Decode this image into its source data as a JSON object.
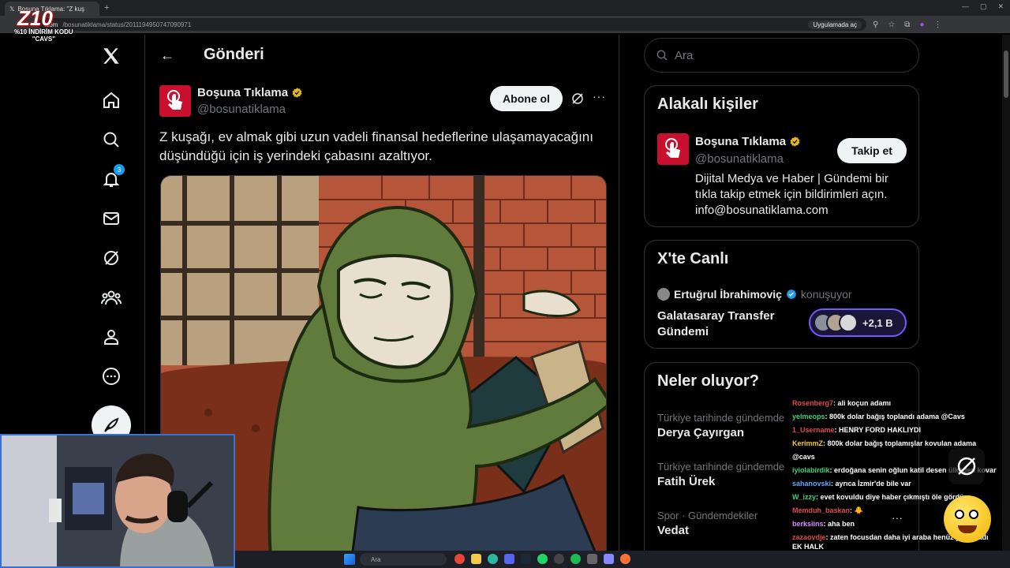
{
  "browser": {
    "tab_title": "Boşuna Tıklama: \"Z kuş",
    "new_tab": "+",
    "url_host": ".com",
    "url_path": "/bosunatiklama/status/2011194950747090971",
    "open_app": "Uygulamada aç"
  },
  "overlay": {
    "logo": "Z10",
    "promo_line1": "%10 İNDİRİM KODU",
    "promo_line2": "\"CAVS\""
  },
  "nav": {
    "notifications_badge": "3",
    "icons": [
      "x-logo",
      "home-icon",
      "search-icon",
      "notifications-icon",
      "messages-icon",
      "grok-icon",
      "communities-icon",
      "profile-icon",
      "more-icon"
    ]
  },
  "main": {
    "header_title": "Gönderi",
    "author_name": "Boşuna Tıklama",
    "author_handle": "@bosunatiklama",
    "subscribe_label": "Abone ol",
    "more": "···",
    "post_text": "Z kuşağı, ev almak gibi uzun vadeli finansal hedeflerine ulaşamayacağını düşündüğü için iş yerindeki çabasını azaltıyor."
  },
  "right": {
    "search_placeholder": "Ara",
    "related_title": "Alakalı kişiler",
    "related_name": "Boşuna Tıklama",
    "related_handle": "@bosunatiklama",
    "follow_label": "Takip et",
    "related_bio": "Dijital Medya ve Haber | Gündemi bir tıkla takip etmek için bildirimleri açın. info@bosunatiklama.com",
    "live_title": "X'te Canlı",
    "live_host": "Ertuğrul İbrahimoviç",
    "live_status": "konuşuyor",
    "live_space": "Galatasaray Transfer Gündemi",
    "live_count": "+2,1 B",
    "trends_title": "Neler oluyor?",
    "trends": [
      {
        "context": "Türkiye tarihinde gündemde",
        "name": "Derya Çayırgan"
      },
      {
        "context": "Türkiye tarihinde gündemde",
        "name": "Fatih Ürek"
      },
      {
        "context": "Spor · Gündemdekiler",
        "name": "Vedat"
      }
    ]
  },
  "chat": [
    {
      "user": "Rosenberg7",
      "color": "#e5484d",
      "msg": ": ali koçun adamı"
    },
    {
      "user": "yelmeops",
      "color": "#3ad17a",
      "msg": ": 800k dolar bağış toplandı adama @Cavs"
    },
    {
      "user": "1_Username",
      "color": "#e5484d",
      "msg": ": HENRY FORD HAKLIYDI"
    },
    {
      "user": "KerimmZ",
      "color": "#f5c842",
      "msg": ": 800k dolar bağış toplamışlar kovulan adama"
    },
    {
      "user": "",
      "color": "#ffffff",
      "msg": "@cavs"
    },
    {
      "user": "iyiolabirdik",
      "color": "#3ad17a",
      "msg": ": erdoğana senin oğlun katil desen ülkeden kovar"
    },
    {
      "user": "sahanovski",
      "color": "#5aa9ff",
      "msg": ": ayrıca İzmir'de bile var"
    },
    {
      "user": "W_izzy",
      "color": "#3ad17a",
      "msg": ": evet kovuldu diye haber çıkmıştı öle gördüm"
    },
    {
      "user": "Memduh_baskan",
      "color": "#e5484d",
      "msg": ": 🐥"
    },
    {
      "user": "berksiins",
      "color": "#d98cff",
      "msg": ": aha ben"
    },
    {
      "user": "zazaovdje",
      "color": "#e5484d",
      "msg": ": zaten focusdan daha iyi araba henüz yapılmadı"
    }
  ],
  "chat_tail": "EK HALK",
  "taskbar": {
    "search": "Ara"
  }
}
